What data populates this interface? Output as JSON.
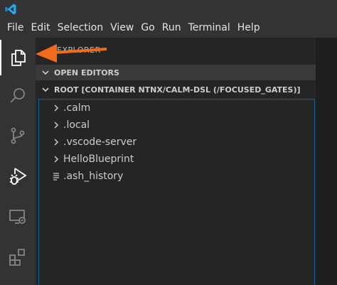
{
  "menubar": {
    "items": [
      "File",
      "Edit",
      "Selection",
      "View",
      "Go",
      "Run",
      "Terminal",
      "Help"
    ]
  },
  "icons": {
    "logo": "vscode-logo-icon",
    "explorer": "files-icon",
    "search": "search-icon",
    "source_control": "source-control-icon",
    "run_debug": "run-debug-icon",
    "remote_explorer": "remote-explorer-icon",
    "extensions": "extensions-icon"
  },
  "sidebar": {
    "title": "EXPLORER",
    "open_editors": "OPEN EDITORS",
    "root": "ROOT [CONTAINER NTNX/CALM-DSL (/FOCUSED_GATES)]",
    "tree": [
      {
        "label": ".calm",
        "type": "folder"
      },
      {
        "label": ".local",
        "type": "folder"
      },
      {
        "label": ".vscode-server",
        "type": "folder"
      },
      {
        "label": "HelloBlueprint",
        "type": "folder"
      },
      {
        "label": ".ash_history",
        "type": "file"
      }
    ]
  },
  "colors": {
    "accent": "#0e639c",
    "annotation_arrow": "#f26b1d",
    "logo": "#23a8f2"
  }
}
